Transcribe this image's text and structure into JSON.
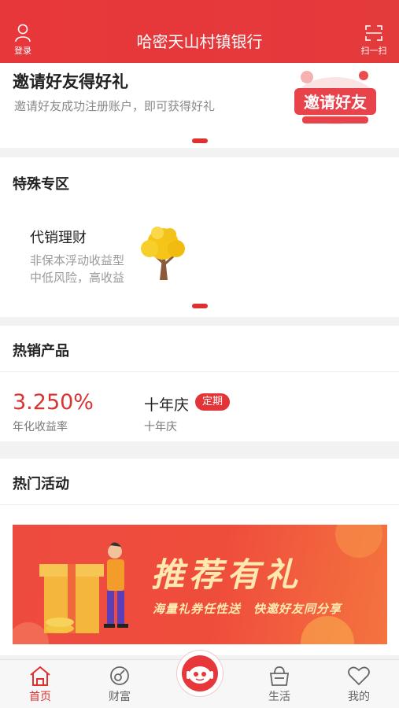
{
  "header": {
    "login_label": "登录",
    "title": "哈密天山村镇银行",
    "scan_label": "扫一扫"
  },
  "invite": {
    "title": "邀请好友得好礼",
    "subtitle": "邀请好友成功注册账户，即可获得好礼",
    "banner_text": "邀请好友"
  },
  "special": {
    "title": "特殊专区",
    "item": {
      "title": "代销理财",
      "line1": "非保本浮动收益型",
      "line2": "中低风险，高收益"
    }
  },
  "hot": {
    "title": "热销产品",
    "rate": "3.250%",
    "rate_label": "年化收益率",
    "product_name": "十年庆",
    "badge": "定期",
    "product_sub": "十年庆"
  },
  "activity": {
    "title": "热门活动",
    "banner_title": "推荐有礼",
    "banner_sub": "海量礼券任性送　快邀好友同分享"
  },
  "tabbar": {
    "home": "首页",
    "wealth": "财富",
    "life": "生活",
    "mine": "我的"
  },
  "colors": {
    "brand_red": "#e33a3c",
    "badge_red": "#e33538",
    "rate_red": "#d93333"
  }
}
